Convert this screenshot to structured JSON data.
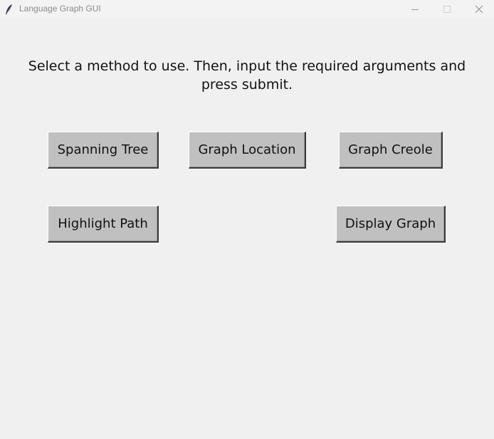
{
  "window": {
    "title": "Language Graph GUI",
    "icons": {
      "app": "feather-icon",
      "minimize": "minimize-icon",
      "maximize": "maximize-icon",
      "close": "close-icon"
    }
  },
  "main": {
    "instructions": "Select a method to use. Then, input the required arguments and press submit.",
    "buttons": {
      "spanning_tree": "Spanning Tree",
      "graph_location": "Graph Location",
      "graph_creole": "Graph Creole",
      "highlight_path": "Highlight Path",
      "display_graph": "Display Graph"
    }
  },
  "colors": {
    "background": "#f0f0f0",
    "button_face": "#c0c0c0",
    "title_text": "#8a8a8a"
  }
}
